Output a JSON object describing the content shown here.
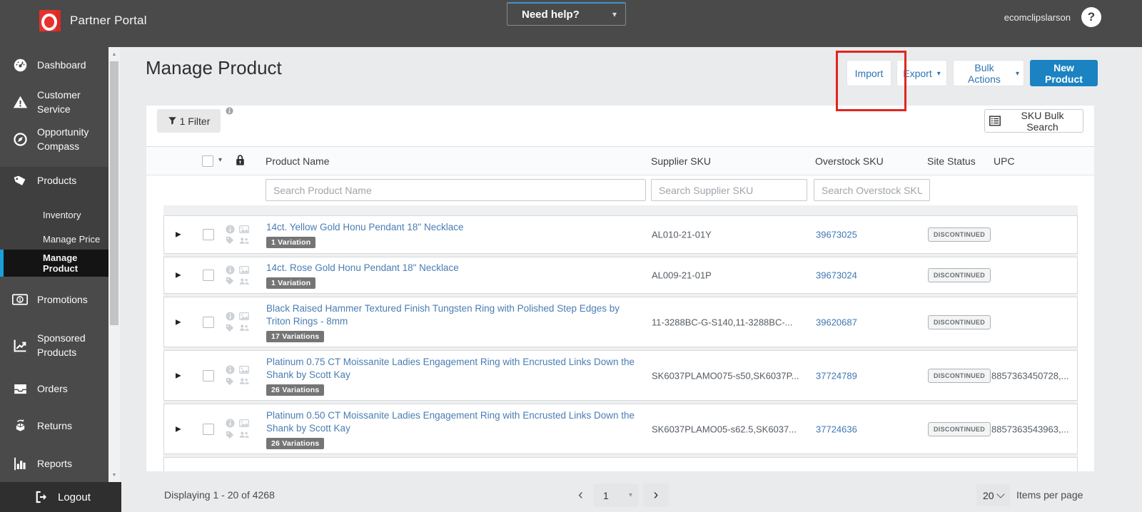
{
  "icons": {
    "caret_down": "▾",
    "chevron_left": "‹",
    "chevron_right": "›",
    "expand_arrow": "▶",
    "question_mark": "?",
    "scroll_up": "▲",
    "scroll_down": "▼"
  },
  "colors": {
    "header_bg": "#4a4a4a",
    "logo_red": "#e8302c",
    "active_nav_accent": "#1a9fd9",
    "primary_button_blue": "#1b83c1",
    "link_blue": "#4a7db3",
    "annotation_red": "#e2241f"
  },
  "header": {
    "brand": "Partner Portal",
    "help_label": "Need help?",
    "username": "ecomclipslarson"
  },
  "sidebar": {
    "items": [
      {
        "label": "Dashboard"
      },
      {
        "label": "Customer Service"
      },
      {
        "label": "Opportunity Compass"
      },
      {
        "label": "Products"
      },
      {
        "label": "Inventory"
      },
      {
        "label": "Manage Price"
      },
      {
        "label": "Manage Product",
        "active": true
      },
      {
        "label": "Promotions"
      },
      {
        "label": "Sponsored Products"
      },
      {
        "label": "Orders"
      },
      {
        "label": "Returns"
      },
      {
        "label": "Reports"
      },
      {
        "label": "Logout"
      }
    ]
  },
  "page": {
    "title": "Manage Product",
    "toolbar": {
      "import_label": "Import",
      "export_label": "Export",
      "bulk_actions_label": "Bulk Actions",
      "new_product_label": "New Product"
    },
    "filter_label": "1 Filter",
    "sku_bulk_search_label": "SKU Bulk Search"
  },
  "table": {
    "headers": {
      "product_name": "Product Name",
      "supplier_sku": "Supplier SKU",
      "overstock_sku": "Overstock SKU",
      "site_status": "Site Status",
      "upc": "UPC"
    },
    "search": {
      "product_name_placeholder": "Search Product Name",
      "supplier_sku_placeholder": "Search Supplier SKU",
      "overstock_sku_placeholder": "Search Overstock SKU"
    },
    "rows": [
      {
        "name": "14ct. Yellow Gold Honu Pendant 18\" Necklace",
        "variations": "1 Variation",
        "supplier_sku": "AL010-21-01Y",
        "overstock_sku": "39673025",
        "site_status": "DISCONTINUED",
        "upc": ""
      },
      {
        "name": "14ct. Rose Gold Honu Pendant 18\" Necklace",
        "variations": "1 Variation",
        "supplier_sku": "AL009-21-01P",
        "overstock_sku": "39673024",
        "site_status": "DISCONTINUED",
        "upc": ""
      },
      {
        "name": "Black Raised Hammer Textured Finish Tungsten Ring with Polished Step Edges by Triton Rings - 8mm",
        "variations": "17 Variations",
        "supplier_sku": "11-3288BC-G-S140,11-3288BC-...",
        "overstock_sku": "39620687",
        "site_status": "DISCONTINUED",
        "upc": ""
      },
      {
        "name": "Platinum 0.75 CT Moissanite Ladies Engagement Ring with Encrusted Links Down the Shank by Scott Kay",
        "variations": "26 Variations",
        "supplier_sku": "SK6037PLAMO075-s50,SK6037P...",
        "overstock_sku": "37724789",
        "site_status": "DISCONTINUED",
        "upc": "8857363450728,..."
      },
      {
        "name": "Platinum 0.50 CT Moissanite Ladies Engagement Ring with Encrusted Links Down the Shank by Scott Kay",
        "variations": "26 Variations",
        "supplier_sku": "SK6037PLAMO05-s62.5,SK6037...",
        "overstock_sku": "37724636",
        "site_status": "DISCONTINUED",
        "upc": "8857363543963,..."
      }
    ]
  },
  "footer": {
    "displaying": "Displaying 1 - 20 of 4268",
    "current_page": "1",
    "items_per_page": "20",
    "items_per_page_label": "Items per page"
  }
}
